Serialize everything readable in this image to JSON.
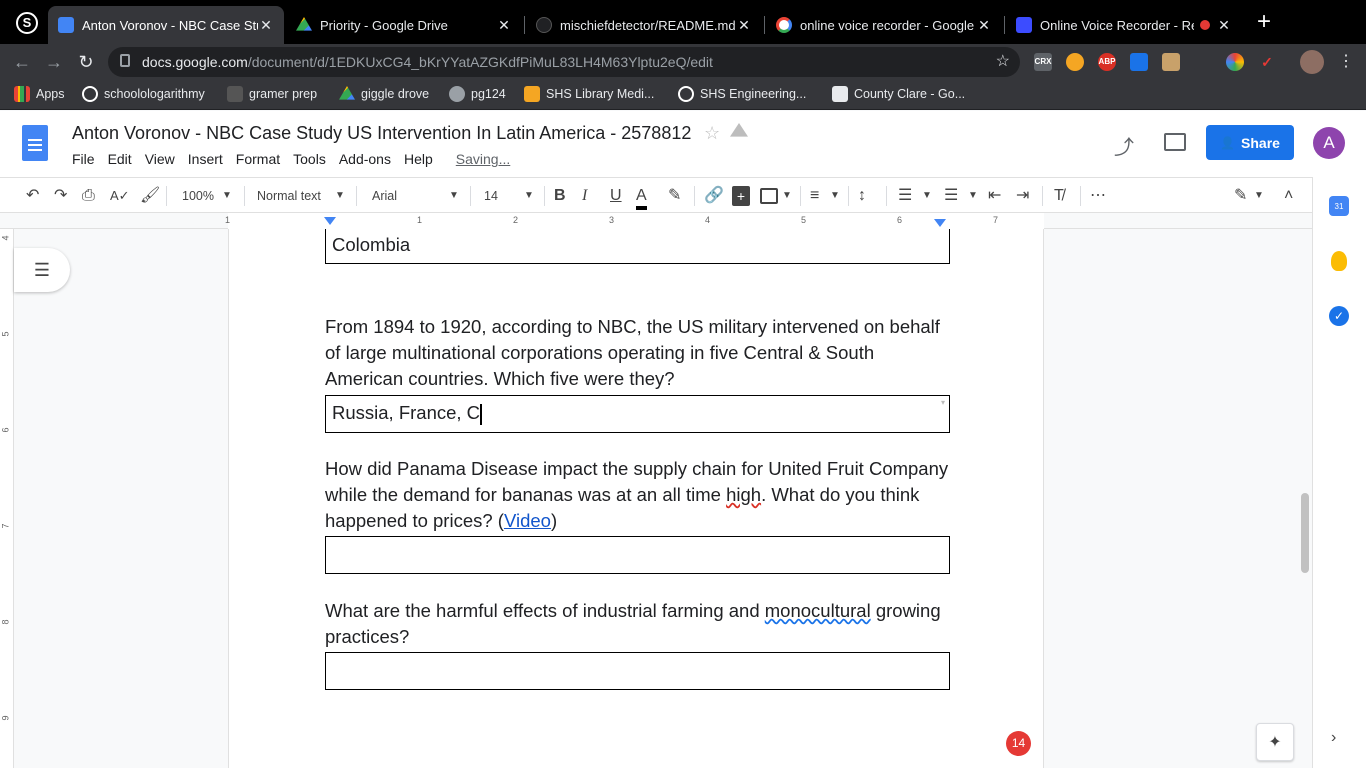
{
  "browser": {
    "tabs": [
      {
        "title": "Anton Voronov - NBC Case Stu",
        "active": true,
        "favicon_color": "#4285f4",
        "favicon": "docs-icon"
      },
      {
        "title": "Priority - Google Drive",
        "active": false,
        "favicon_color": "#fbbc04",
        "favicon": "drive-icon"
      },
      {
        "title": "mischiefdetector/README.md",
        "active": false,
        "favicon_color": "#202124",
        "favicon": "github-icon"
      },
      {
        "title": "online voice recorder - Google",
        "active": false,
        "favicon_color": "#ffffff",
        "favicon": "google-icon"
      },
      {
        "title": "Online Voice Recorder - Re",
        "active": false,
        "favicon_color": "#3c4cff",
        "favicon": "recorder-icon"
      }
    ],
    "new_tab": "+",
    "url_host": "docs.google.com",
    "url_path": "/document/d/1EDKUxCG4_bKrYYatAZGKdfPiMuL83LH4M63Ylptu2eQ/edit",
    "extensions": [
      "CRX",
      "ABP"
    ],
    "bookmarks": [
      {
        "label": "Apps",
        "icon_color": "#ea4335"
      },
      {
        "label": "schoolologarithmy",
        "icon_color": "#1a73e8"
      },
      {
        "label": "gramer prep",
        "icon_color": "#555555"
      },
      {
        "label": "giggle drove",
        "icon_color": "#fbbc04"
      },
      {
        "label": "pg124",
        "icon_color": "#9aa0a6"
      },
      {
        "label": "SHS Library Medi...",
        "icon_color": "#f5a623"
      },
      {
        "label": "SHS Engineering...",
        "icon_color": "#1a73e8"
      },
      {
        "label": "County Clare - Go...",
        "icon_color": "#e8eaed"
      }
    ]
  },
  "docs": {
    "title": "Anton Voronov - NBC Case Study US Intervention In Latin America - 2578812",
    "menu": [
      "File",
      "Edit",
      "View",
      "Insert",
      "Format",
      "Tools",
      "Add-ons",
      "Help"
    ],
    "saving": "Saving...",
    "share_label": "Share",
    "avatar_letter": "A",
    "accent": "#1a73e8"
  },
  "toolbar": {
    "zoom": "100%",
    "style": "Normal text",
    "font": "Arial",
    "size": "14"
  },
  "ruler": {
    "numbers": [
      "1",
      "1",
      "2",
      "3",
      "4",
      "5",
      "6",
      "7"
    ],
    "vertical_numbers": [
      "4",
      "5",
      "6",
      "7",
      "8",
      "9"
    ]
  },
  "document": {
    "box1": "Colombia",
    "q1": "From 1894 to 1920, according to NBC, the US military intervened on behalf of large multinational corporations operating in five Central & South American countries. Which five were they?",
    "box2": "Russia, France, C",
    "q2_pre": "How did Panama Disease impact the supply chain for United Fruit Company while the demand for bananas was at an all time ",
    "q2_err": "high",
    "q2_post": ". What do you think happened to prices? (",
    "q2_link": "Video",
    "q2_end": ")",
    "q3_pre": "What are the harmful effects of industrial farming and ",
    "q3_err": "monocultural",
    "q3_post": " growing practices?"
  },
  "comments_badge": "14"
}
